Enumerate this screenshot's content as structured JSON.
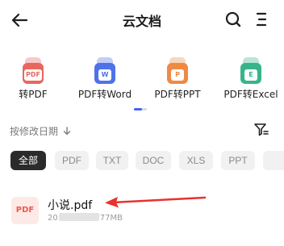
{
  "header": {
    "title": "云文档"
  },
  "tools": [
    {
      "label": "转PDF",
      "badge": "PDF",
      "color": "#e8675e"
    },
    {
      "label": "PDF转Word",
      "badge": "W",
      "color": "#4f72e8"
    },
    {
      "label": "PDF转PPT",
      "badge": "P",
      "color": "#ef8a45"
    },
    {
      "label": "PDF转Excel",
      "badge": "E",
      "color": "#38b48b"
    }
  ],
  "sort": {
    "label": "按修改日期"
  },
  "chips": [
    "全部",
    "PDF",
    "TXT",
    "DOC",
    "XLS",
    "PPT"
  ],
  "file": {
    "icon_text": "PDF",
    "name": "小说.pdf",
    "meta_prefix": "20",
    "meta_size": "77MB"
  }
}
